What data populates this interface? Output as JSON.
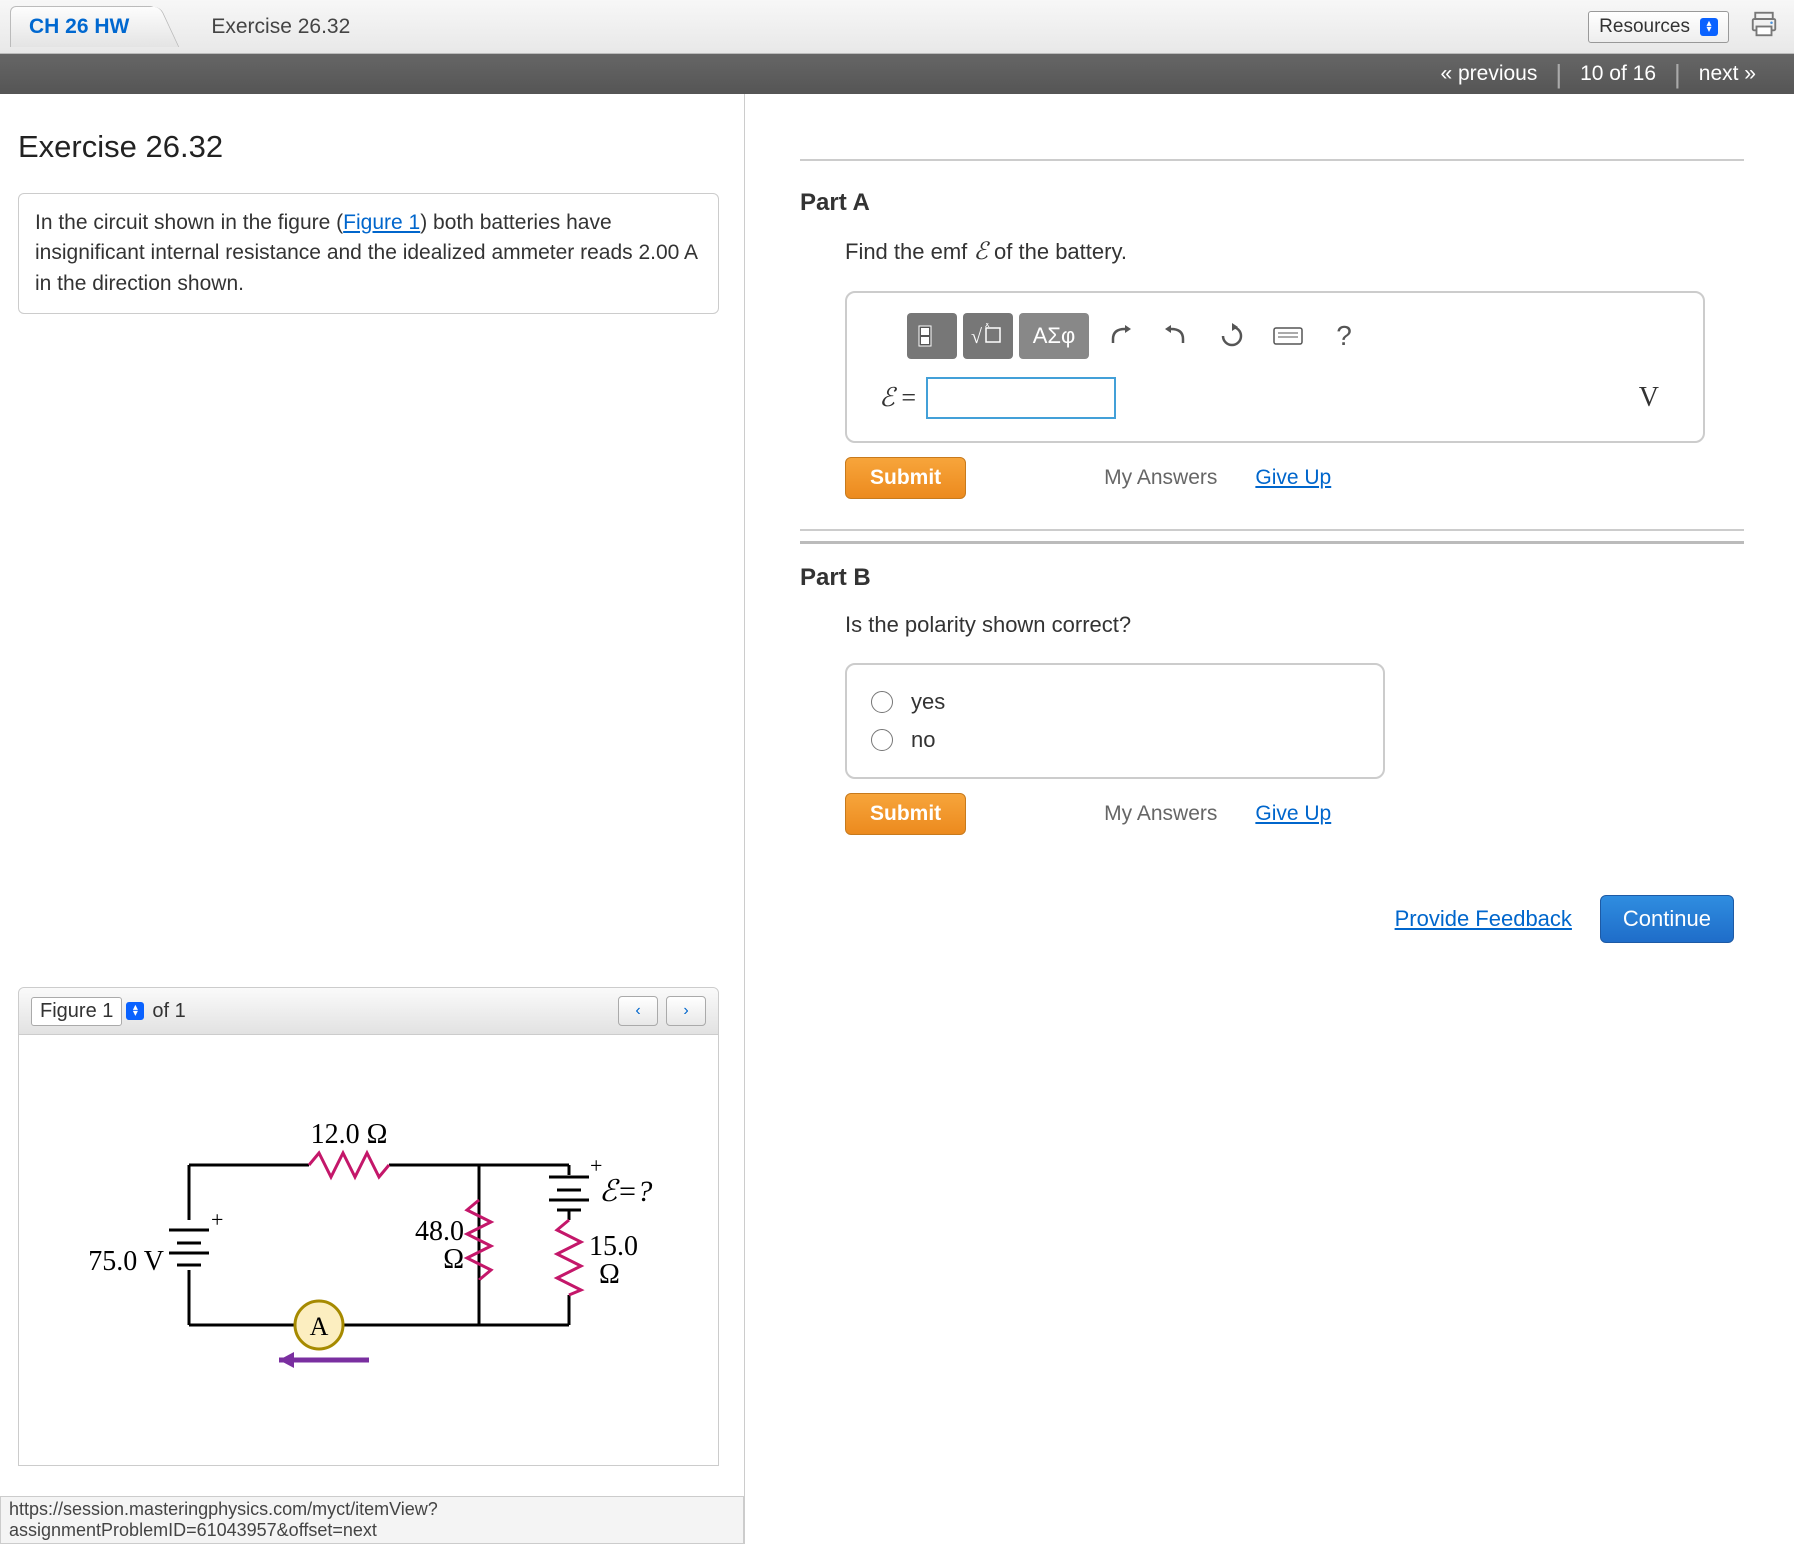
{
  "tabs": {
    "assignment": "CH 26 HW",
    "exercise": "Exercise 26.32"
  },
  "resources_label": "Resources",
  "nav": {
    "prev": "« previous",
    "pos": "10 of 16",
    "next": "next »"
  },
  "left": {
    "title": "Exercise 26.32",
    "problem_pre": "In the circuit shown in the figure (",
    "problem_link": "Figure 1",
    "problem_post": ") both batteries have insignificant internal resistance and the idealized ammeter reads 2.00 A in the direction shown.",
    "figure": {
      "label": "Figure 1",
      "count": "of 1"
    },
    "circuit": {
      "r_top": "12.0 Ω",
      "r_mid": "48.0 Ω",
      "r_right": "15.0 Ω",
      "v_left": "75.0 V",
      "emf": "ℰ=?",
      "ammeter": "A"
    }
  },
  "partA": {
    "heading": "Part A",
    "question_pre": "Find the emf ",
    "question_sym": "ℰ",
    "question_post": " of the battery.",
    "toolbar": {
      "greek": "ΑΣφ",
      "help": "?"
    },
    "var": "ℰ",
    "eq": "=",
    "unit": "V",
    "submit": "Submit",
    "myans": "My Answers",
    "giveup": "Give Up"
  },
  "partB": {
    "heading": "Part B",
    "question": "Is the polarity shown correct?",
    "opt1": "yes",
    "opt2": "no",
    "submit": "Submit",
    "myans": "My Answers",
    "giveup": "Give Up"
  },
  "footer": {
    "feedback": "Provide Feedback",
    "continue": "Continue"
  },
  "status_url": "https://session.masteringphysics.com/myct/itemView?assignmentProblemID=61043957&offset=next"
}
